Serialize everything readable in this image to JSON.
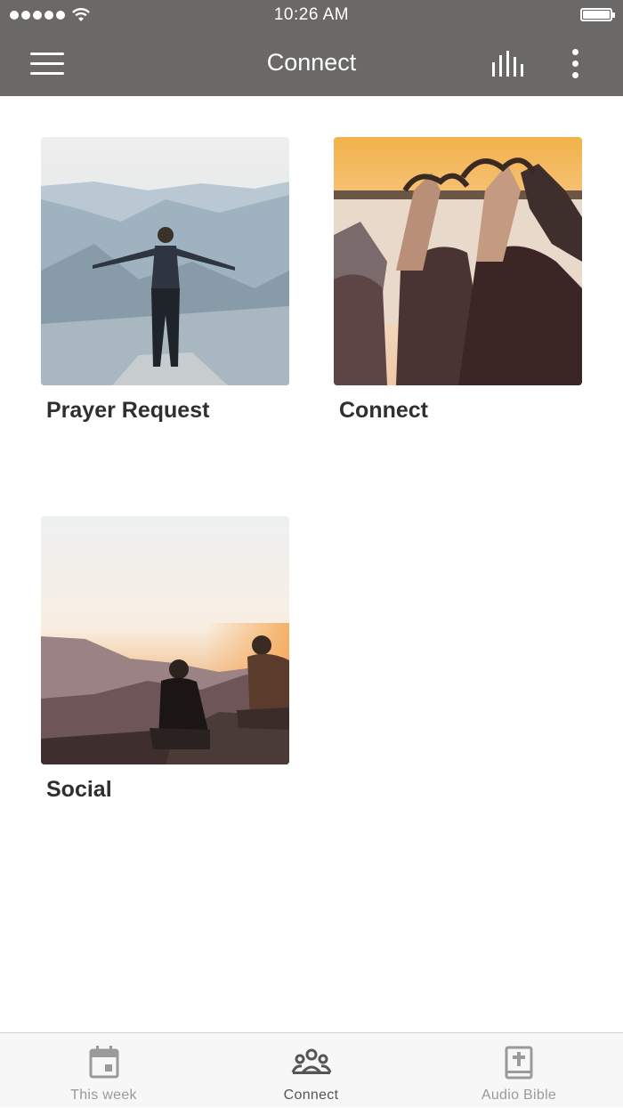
{
  "status_bar": {
    "time": "10:26 AM"
  },
  "header": {
    "title": "Connect",
    "menu_icon": "hamburger-icon",
    "audio_icon": "equalizer-icon",
    "more_icon": "more-vertical-icon"
  },
  "cards": [
    {
      "label": "Prayer Request",
      "image": "person with outstretched arms on mountain cliff"
    },
    {
      "label": "Connect",
      "image": "friends making heart shapes with hands at sunset lake"
    },
    {
      "label": "Social",
      "image": "two people sitting on rocks watching mountain sunset"
    }
  ],
  "tabs": [
    {
      "label": "This week",
      "icon": "calendar-icon",
      "active": false
    },
    {
      "label": "Connect",
      "icon": "group-icon",
      "active": true
    },
    {
      "label": "Audio Bible",
      "icon": "bible-icon",
      "active": false
    }
  ],
  "colors": {
    "header_bg": "#6a6967",
    "tab_inactive": "#9a9a9a",
    "tab_active": "#555555",
    "label_text": "#2f2f2f"
  }
}
